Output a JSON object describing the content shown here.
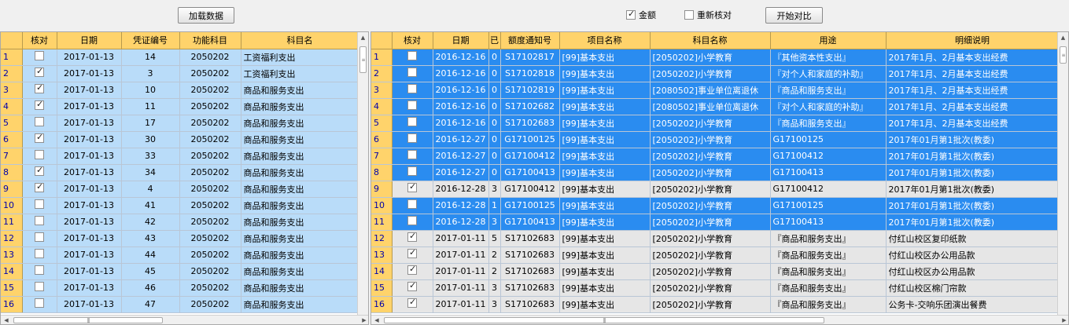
{
  "toolbar": {
    "load_label": "加载数据",
    "amount_label": "金额",
    "amount_checked": true,
    "recheck_label": "重新核对",
    "recheck_checked": false,
    "compare_label": "开始对比"
  },
  "left_grid": {
    "columns": [
      "核对",
      "日期",
      "凭证编号",
      "功能科目",
      "科目名"
    ],
    "rows": [
      {
        "n": "1",
        "check": false,
        "date": "2017-01-13",
        "voucher": "14",
        "func": "2050202",
        "subject": "工资福利支出"
      },
      {
        "n": "2",
        "check": true,
        "date": "2017-01-13",
        "voucher": "3",
        "func": "2050202",
        "subject": "工资福利支出"
      },
      {
        "n": "3",
        "check": true,
        "date": "2017-01-13",
        "voucher": "10",
        "func": "2050202",
        "subject": "商品和服务支出"
      },
      {
        "n": "4",
        "check": true,
        "date": "2017-01-13",
        "voucher": "11",
        "func": "2050202",
        "subject": "商品和服务支出"
      },
      {
        "n": "5",
        "check": false,
        "date": "2017-01-13",
        "voucher": "17",
        "func": "2050202",
        "subject": "商品和服务支出"
      },
      {
        "n": "6",
        "check": true,
        "date": "2017-01-13",
        "voucher": "30",
        "func": "2050202",
        "subject": "商品和服务支出"
      },
      {
        "n": "7",
        "check": false,
        "date": "2017-01-13",
        "voucher": "33",
        "func": "2050202",
        "subject": "商品和服务支出"
      },
      {
        "n": "8",
        "check": true,
        "date": "2017-01-13",
        "voucher": "34",
        "func": "2050202",
        "subject": "商品和服务支出"
      },
      {
        "n": "9",
        "check": true,
        "date": "2017-01-13",
        "voucher": "4",
        "func": "2050202",
        "subject": "商品和服务支出"
      },
      {
        "n": "10",
        "check": false,
        "date": "2017-01-13",
        "voucher": "41",
        "func": "2050202",
        "subject": "商品和服务支出"
      },
      {
        "n": "11",
        "check": false,
        "date": "2017-01-13",
        "voucher": "42",
        "func": "2050202",
        "subject": "商品和服务支出"
      },
      {
        "n": "12",
        "check": false,
        "date": "2017-01-13",
        "voucher": "43",
        "func": "2050202",
        "subject": "商品和服务支出"
      },
      {
        "n": "13",
        "check": false,
        "date": "2017-01-13",
        "voucher": "44",
        "func": "2050202",
        "subject": "商品和服务支出"
      },
      {
        "n": "14",
        "check": false,
        "date": "2017-01-13",
        "voucher": "45",
        "func": "2050202",
        "subject": "商品和服务支出"
      },
      {
        "n": "15",
        "check": false,
        "date": "2017-01-13",
        "voucher": "46",
        "func": "2050202",
        "subject": "商品和服务支出"
      },
      {
        "n": "16",
        "check": false,
        "date": "2017-01-13",
        "voucher": "47",
        "func": "2050202",
        "subject": "商品和服务支出"
      }
    ]
  },
  "right_grid": {
    "columns": [
      "核对",
      "日期",
      "已",
      "额度通知号",
      "项目名称",
      "科目名称",
      "用途",
      "明细说明"
    ],
    "rows": [
      {
        "n": "1",
        "style": "blue",
        "check": false,
        "date": "2016-12-16",
        "yi": "0",
        "notice": "S17102817",
        "project": "[99]基本支出",
        "subject": "[2050202]小学教育",
        "usage": "『其他资本性支出』",
        "detail": "2017年1月、2月基本支出经费"
      },
      {
        "n": "2",
        "style": "blue",
        "check": false,
        "date": "2016-12-16",
        "yi": "0",
        "notice": "S17102818",
        "project": "[99]基本支出",
        "subject": "[2050202]小学教育",
        "usage": "『对个人和家庭的补助』",
        "detail": "2017年1月、2月基本支出经费"
      },
      {
        "n": "3",
        "style": "blue",
        "check": false,
        "date": "2016-12-16",
        "yi": "0",
        "notice": "S17102819",
        "project": "[99]基本支出",
        "subject": "[2080502]事业单位离退休",
        "usage": "『商品和服务支出』",
        "detail": "2017年1月、2月基本支出经费"
      },
      {
        "n": "4",
        "style": "blue",
        "check": false,
        "date": "2016-12-16",
        "yi": "0",
        "notice": "S17102682",
        "project": "[99]基本支出",
        "subject": "[2080502]事业单位离退休",
        "usage": "『对个人和家庭的补助』",
        "detail": "2017年1月、2月基本支出经费"
      },
      {
        "n": "5",
        "style": "blue",
        "check": false,
        "date": "2016-12-16",
        "yi": "0",
        "notice": "S17102683",
        "project": "[99]基本支出",
        "subject": "[2050202]小学教育",
        "usage": "『商品和服务支出』",
        "detail": "2017年1月、2月基本支出经费"
      },
      {
        "n": "6",
        "style": "blue",
        "check": false,
        "date": "2016-12-27",
        "yi": "0",
        "notice": "G17100125",
        "project": "[99]基本支出",
        "subject": "[2050202]小学教育",
        "usage": "G17100125",
        "detail": "2017年01月第1批次(教委)"
      },
      {
        "n": "7",
        "style": "blue",
        "check": false,
        "date": "2016-12-27",
        "yi": "0",
        "notice": "G17100412",
        "project": "[99]基本支出",
        "subject": "[2050202]小学教育",
        "usage": "G17100412",
        "detail": "2017年01月第1批次(教委)"
      },
      {
        "n": "8",
        "style": "blue",
        "check": false,
        "date": "2016-12-27",
        "yi": "0",
        "notice": "G17100413",
        "project": "[99]基本支出",
        "subject": "[2050202]小学教育",
        "usage": "G17100413",
        "detail": "2017年01月第1批次(教委)"
      },
      {
        "n": "9",
        "style": "gray",
        "check": true,
        "date": "2016-12-28",
        "yi": "3",
        "notice": "G17100412",
        "project": "[99]基本支出",
        "subject": "[2050202]小学教育",
        "usage": "G17100412",
        "detail": "2017年01月第1批次(教委)"
      },
      {
        "n": "10",
        "style": "blue",
        "check": false,
        "date": "2016-12-28",
        "yi": "1",
        "notice": "G17100125",
        "project": "[99]基本支出",
        "subject": "[2050202]小学教育",
        "usage": "G17100125",
        "detail": "2017年01月第1批次(教委)"
      },
      {
        "n": "11",
        "style": "blue",
        "check": false,
        "date": "2016-12-28",
        "yi": "3",
        "notice": "G17100413",
        "project": "[99]基本支出",
        "subject": "[2050202]小学教育",
        "usage": "G17100413",
        "detail": "2017年01月第1批次(教委)"
      },
      {
        "n": "12",
        "style": "gray",
        "check": true,
        "date": "2017-01-11",
        "yi": "5",
        "notice": "S17102683",
        "project": "[99]基本支出",
        "subject": "[2050202]小学教育",
        "usage": "『商品和服务支出』",
        "detail": "付红山校区复印纸款"
      },
      {
        "n": "13",
        "style": "gray",
        "check": true,
        "date": "2017-01-11",
        "yi": "2",
        "notice": "S17102683",
        "project": "[99]基本支出",
        "subject": "[2050202]小学教育",
        "usage": "『商品和服务支出』",
        "detail": "付红山校区办公用品款"
      },
      {
        "n": "14",
        "style": "gray",
        "check": true,
        "date": "2017-01-11",
        "yi": "2",
        "notice": "S17102683",
        "project": "[99]基本支出",
        "subject": "[2050202]小学教育",
        "usage": "『商品和服务支出』",
        "detail": "付红山校区办公用品款"
      },
      {
        "n": "15",
        "style": "gray",
        "check": true,
        "date": "2017-01-11",
        "yi": "3",
        "notice": "S17102683",
        "project": "[99]基本支出",
        "subject": "[2050202]小学教育",
        "usage": "『商品和服务支出』",
        "detail": "付红山校区棉门帘款"
      },
      {
        "n": "16",
        "style": "gray",
        "check": true,
        "date": "2017-01-11",
        "yi": "3",
        "notice": "S17102683",
        "project": "[99]基本支出",
        "subject": "[2050202]小学教育",
        "usage": "『商品和服务支出』",
        "detail": "公务卡-交响乐团演出餐费"
      }
    ]
  },
  "colors": {
    "header_bg": "#ffd36b",
    "light_row": "#b9dcf9",
    "selected_row": "#2a8cf0",
    "matched_row": "#e6e6e6"
  }
}
